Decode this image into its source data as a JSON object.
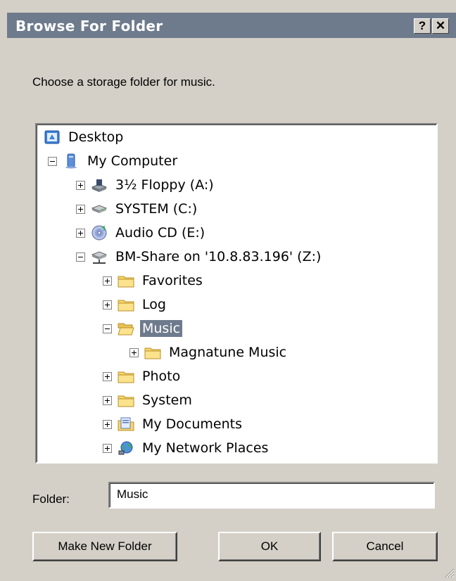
{
  "window": {
    "title": "Browse For Folder",
    "help_label": "?",
    "close_label": "✕"
  },
  "prompt": "Choose a storage folder for music.",
  "tree": {
    "items": [
      {
        "label": "Desktop",
        "icon": "desktop-icon"
      },
      {
        "label": "My Computer",
        "icon": "computer-icon",
        "expanded": true
      },
      {
        "label": "3½ Floppy (A:)",
        "icon": "floppy-drive-icon"
      },
      {
        "label": "SYSTEM (C:)",
        "icon": "hard-drive-icon"
      },
      {
        "label": "Audio CD (E:)",
        "icon": "cd-drive-icon"
      },
      {
        "label": "BM-Share on '10.8.83.196' (Z:)",
        "icon": "network-drive-icon",
        "expanded": true
      },
      {
        "label": "Favorites",
        "icon": "folder-icon"
      },
      {
        "label": "Log",
        "icon": "folder-icon"
      },
      {
        "label": "Music",
        "icon": "open-folder-icon",
        "expanded": true,
        "selected": true
      },
      {
        "label": "Magnatune Music",
        "icon": "folder-icon"
      },
      {
        "label": "Photo",
        "icon": "folder-icon"
      },
      {
        "label": "System",
        "icon": "folder-icon"
      },
      {
        "label": "My Documents",
        "icon": "documents-icon"
      },
      {
        "label": "My Network Places",
        "icon": "network-places-icon"
      }
    ]
  },
  "folder_field": {
    "label": "Folder:",
    "value": "Music"
  },
  "buttons": {
    "make_new_folder": "Make New Folder",
    "ok": "OK",
    "cancel": "Cancel"
  },
  "colors": {
    "titlebar": "#6e7b8c",
    "selection": "#6e7b8c",
    "dialog_bg": "#d4d0c8"
  }
}
